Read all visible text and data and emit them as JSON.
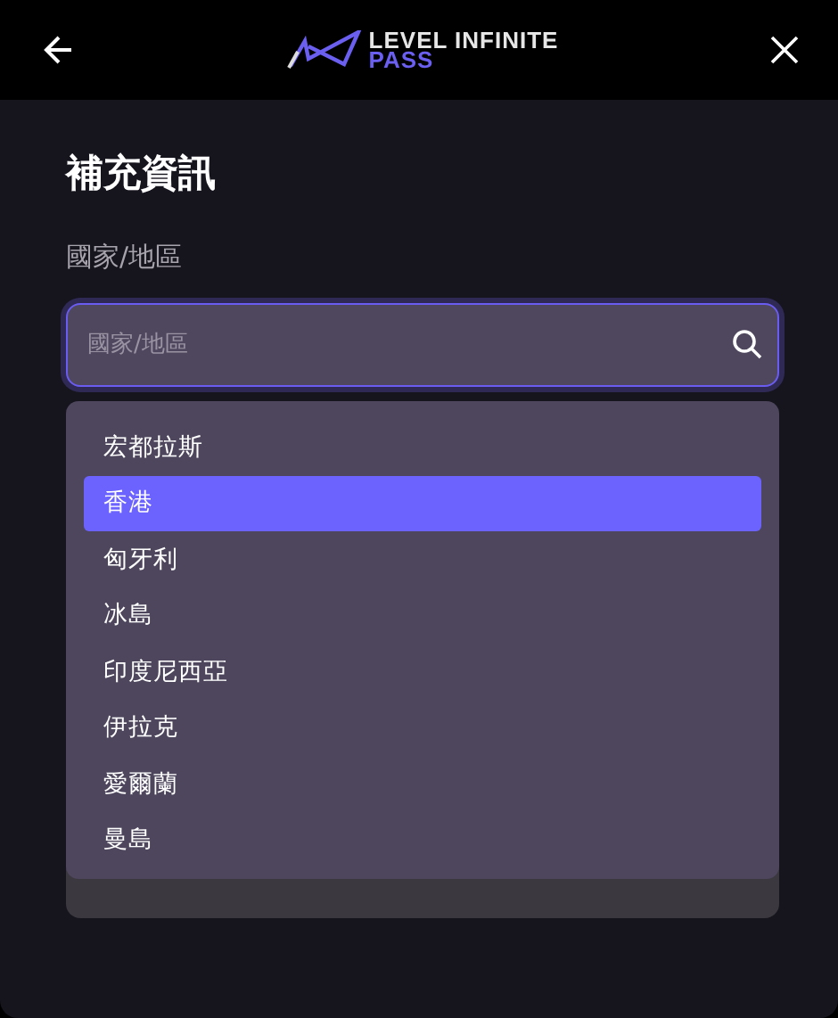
{
  "header": {
    "logo_top": "LEVEL INFINITE",
    "logo_bottom": "PASS"
  },
  "title": "補充資訊",
  "country_field": {
    "label": "國家/地區",
    "placeholder": "國家/地區"
  },
  "dropdown": {
    "options": [
      {
        "label": "宏都拉斯",
        "selected": false
      },
      {
        "label": "香港",
        "selected": true
      },
      {
        "label": "匈牙利",
        "selected": false
      },
      {
        "label": "冰島",
        "selected": false
      },
      {
        "label": "印度尼西亞",
        "selected": false
      },
      {
        "label": "伊拉克",
        "selected": false
      },
      {
        "label": "愛爾蘭",
        "selected": false
      },
      {
        "label": "曼島",
        "selected": false
      }
    ]
  },
  "submit_button": {
    "disabled": true
  }
}
